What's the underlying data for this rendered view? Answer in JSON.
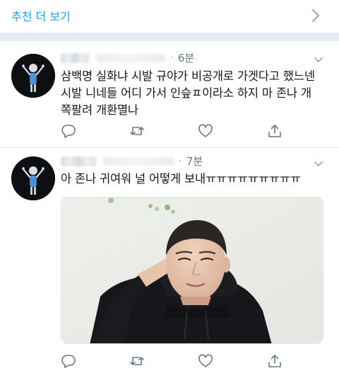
{
  "recommend": {
    "label": "추천 더 보기",
    "chevron_icon": "chevron-right-icon"
  },
  "tweets": [
    {
      "time": "6분",
      "text_lines": [
        "삼백명 실화냐 시발 규야가 비공개로 가겟다고 했느넨",
        "시발 니네들 어디 가서 인슾ㅍ이라소 하지 마 존나 개",
        "쪽팔려 개환멸나"
      ],
      "actions": [
        "reply-icon",
        "retweet-icon",
        "like-icon",
        "share-icon"
      ]
    },
    {
      "time": "7분",
      "text_lines": [
        "아 존나 귀여워 널 어떻게 보내ㅠㅠㅠㅠㅠㅠㅠㅠㅠ"
      ],
      "has_photo": true,
      "actions": [
        "reply-icon",
        "retweet-icon",
        "like-icon",
        "share-icon"
      ]
    }
  ],
  "colors": {
    "accent": "#1da1f2",
    "meta_gray": "#657786",
    "icon_gray": "#657786",
    "separator": "#e6ecf0"
  }
}
